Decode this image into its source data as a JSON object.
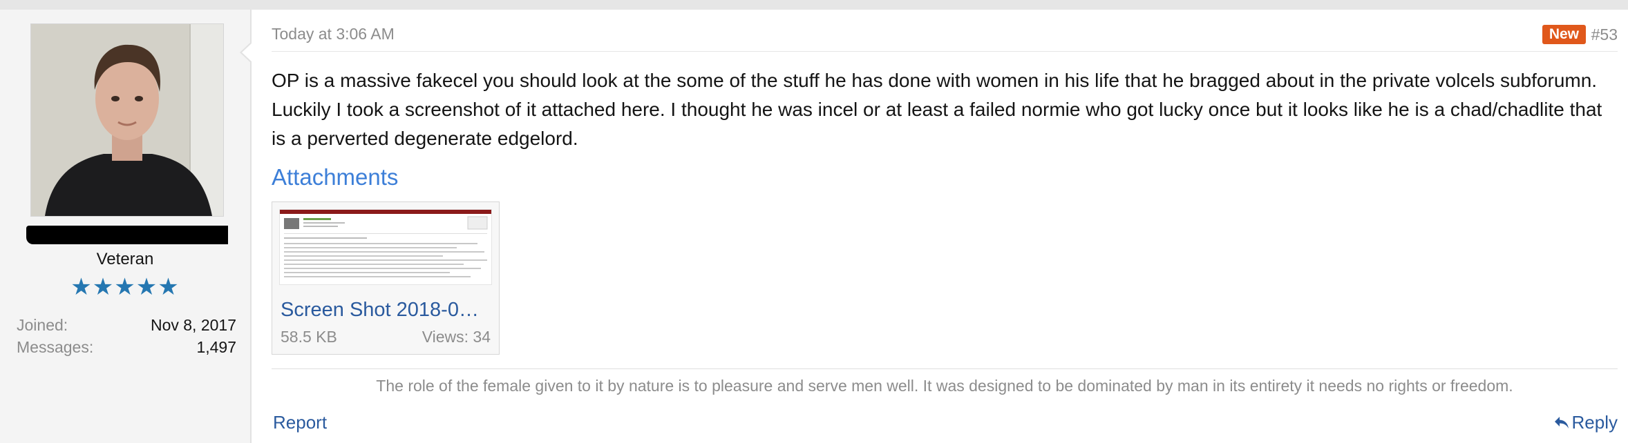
{
  "user": {
    "title": "Veteran",
    "stars": "★★★★★",
    "joined_label": "Joined:",
    "joined_value": "Nov 8, 2017",
    "messages_label": "Messages:",
    "messages_value": "1,497"
  },
  "post": {
    "date": "Today at 3:06 AM",
    "badge": "New",
    "number": "#53",
    "body": "OP is a massive fakecel you should look at the some of the stuff he has done with women in his life that he bragged about in the private volcels subforumn. Luckily I took a screenshot of it attached here. I thought he was incel or at least a failed normie who got lucky once but it looks like he is a chad/chadlite that is a perverted degenerate edgelord.",
    "attachments_heading": "Attachments",
    "attachment": {
      "name": "Screen Shot 2018-0…",
      "size": "58.5 KB",
      "views": "Views: 34"
    },
    "signature": "The role of the female given to it by nature is to pleasure and serve men well. It was designed to be dominated by man in its entirety it needs no rights or freedom.",
    "report_label": "Report",
    "reply_label": "Reply"
  },
  "colors": {
    "badge": "#e0581b",
    "link": "#2a5a9e",
    "stars": "#2577b1",
    "heading": "#3d7fd8"
  }
}
